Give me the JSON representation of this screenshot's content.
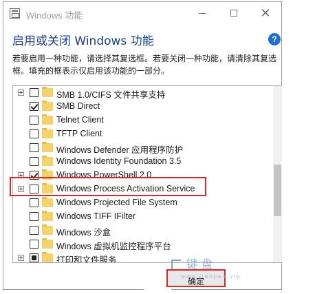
{
  "window": {
    "title": "Windows 功能",
    "icon": "windows-features-icon"
  },
  "controls": {
    "minimize_icon": "minimize-icon",
    "maximize_icon": "maximize-icon",
    "close_icon": "close-icon",
    "close_glyph": "✕"
  },
  "header": {
    "heading": "启用或关闭 Windows 功能",
    "help_glyph": "?",
    "description": "若要启用一种功能，请选择其复选框。若要关闭一种功能，请清除其复选框。填充的框表示仅启用该功能的一部分。"
  },
  "features": [
    {
      "label": "SMB 1.0/CIFS 文件共享支持",
      "state": "unchecked",
      "expandable": true
    },
    {
      "label": "SMB Direct",
      "state": "checked",
      "expandable": false
    },
    {
      "label": "Telnet Client",
      "state": "unchecked",
      "expandable": false
    },
    {
      "label": "TFTP Client",
      "state": "unchecked",
      "expandable": false
    },
    {
      "label": "Windows Defender 应用程序防护",
      "state": "unchecked",
      "expandable": false
    },
    {
      "label": "Windows Identity Foundation 3.5",
      "state": "unchecked",
      "expandable": false
    },
    {
      "label": "Windows PowerShell 2.0",
      "state": "checked",
      "expandable": true
    },
    {
      "label": "Windows Process Activation Service",
      "state": "unchecked",
      "expandable": true
    },
    {
      "label": "Windows Projected File System",
      "state": "unchecked",
      "expandable": false
    },
    {
      "label": "Windows TIFF IFilter",
      "state": "unchecked",
      "expandable": false
    },
    {
      "label": "Windows 沙盒",
      "state": "unchecked",
      "expandable": false
    },
    {
      "label": "Windows 虚拟机监控程序平台",
      "state": "unchecked",
      "expandable": false
    },
    {
      "label": "打印和文件服务",
      "state": "partial",
      "expandable": true
    }
  ],
  "highlighted_feature": "Windows Process Activation Service",
  "footer": {
    "ok_label": "确定"
  },
  "watermark": {
    "text": "键盘",
    "sub": "www.jianpan.vip"
  },
  "colors": {
    "heading": "#1c3f8f",
    "highlight": "#d8262a",
    "help": "#1d6fd3",
    "folder": "#f6d26b"
  }
}
